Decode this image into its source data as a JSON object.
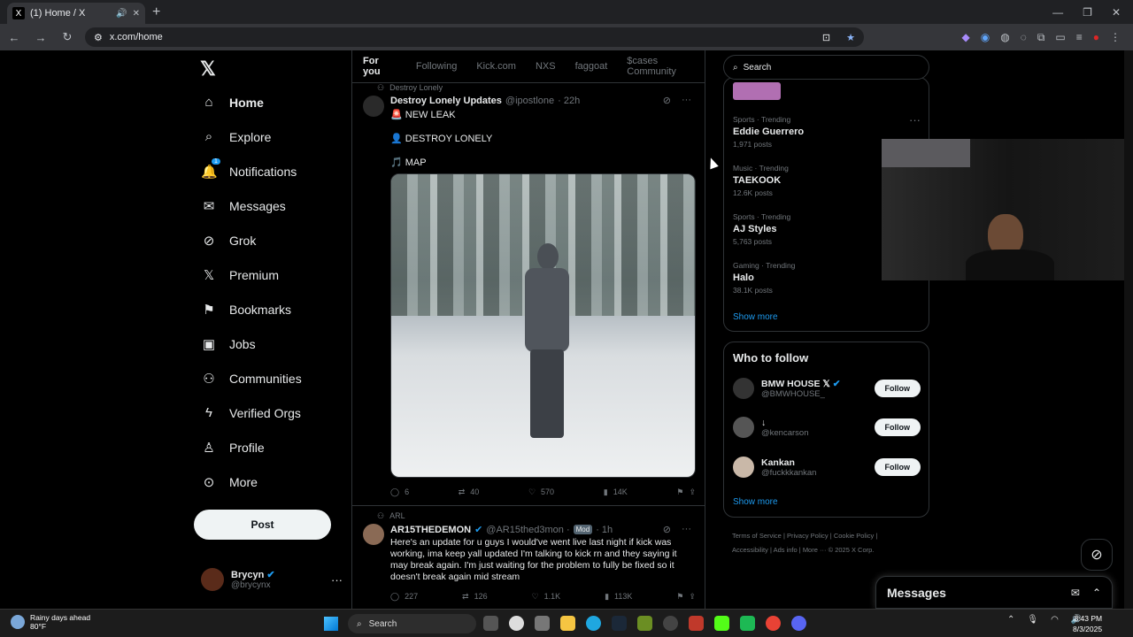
{
  "browser": {
    "tab_title": "(1) Home / X",
    "tab_favicon": "X",
    "new_tab": "+",
    "url": "x.com/home"
  },
  "nav": {
    "items": [
      {
        "label": "Home",
        "icon": "⌂",
        "active": true
      },
      {
        "label": "Explore",
        "icon": "⌕"
      },
      {
        "label": "Notifications",
        "icon": "🔔",
        "badge": "1"
      },
      {
        "label": "Messages",
        "icon": "✉"
      },
      {
        "label": "Grok",
        "icon": "⊘"
      },
      {
        "label": "Premium",
        "icon": "𝕏"
      },
      {
        "label": "Bookmarks",
        "icon": "⚑"
      },
      {
        "label": "Jobs",
        "icon": "▣"
      },
      {
        "label": "Communities",
        "icon": "⚇"
      },
      {
        "label": "Verified Orgs",
        "icon": "ϟ"
      },
      {
        "label": "Profile",
        "icon": "♙"
      },
      {
        "label": "More",
        "icon": "⊙"
      }
    ],
    "post_label": "Post",
    "account": {
      "name": "Brycyn",
      "handle": "@brycynx"
    }
  },
  "feed": {
    "tabs": [
      "For you",
      "Following",
      "Kick.com",
      "NXS",
      "faggoat",
      "$cases Community"
    ],
    "tweet1": {
      "context": "Destroy Lonely",
      "name": "Destroy Lonely Updates",
      "handle": "@ipostlone",
      "time": "· 22h",
      "lines": [
        "🚨 NEW LEAK",
        "👤 DESTROY LONELY",
        "🎵 MAP"
      ],
      "replies": "6",
      "reposts": "40",
      "likes": "570",
      "views": "14K"
    },
    "tweet2": {
      "context": "ARL",
      "name": "AR15THEDEMON",
      "handle": "@AR15thed3mon ·",
      "badge": "Mod",
      "time": "· 1h",
      "text": "Here's an update for u guys I would've went live last night if kick was working, ima keep yall updated I'm talking to kick rn and they saying it may break again. I'm just waiting for the problem to fully be fixed so it doesn't break again mid stream",
      "replies": "227",
      "reposts": "126",
      "likes": "1.1K",
      "views": "113K"
    }
  },
  "sidebar": {
    "search_placeholder": "Search",
    "trends": [
      {
        "category": "Sports · Trending",
        "title": "Eddie Guerrero",
        "posts": "1,971 posts"
      },
      {
        "category": "Music · Trending",
        "title": "TAEKOOK",
        "posts": "12.6K posts"
      },
      {
        "category": "Sports · Trending",
        "title": "AJ Styles",
        "posts": "5,763 posts"
      },
      {
        "category": "Gaming · Trending",
        "title": "Halo",
        "posts": "38.1K posts"
      }
    ],
    "show_more": "Show more",
    "who_to_follow_title": "Who to follow",
    "who_to_follow": [
      {
        "name": "BMW HOUSE 𝕏",
        "handle": "@BMWHOUSE_"
      },
      {
        "name": "↓",
        "handle": "@kencarson"
      },
      {
        "name": "Kankan",
        "handle": "@fuckkkankan"
      }
    ],
    "follow_label": "Follow",
    "footer": [
      "Terms of Service",
      "|",
      "Privacy Policy",
      "|",
      "Cookie Policy",
      "|",
      "Accessibility",
      "|",
      "Ads info",
      "|",
      "More ···",
      "© 2025 X Corp."
    ]
  },
  "messages_bar": {
    "title": "Messages"
  },
  "taskbar": {
    "weather_title": "Rainy days ahead",
    "weather_temp": "80°F",
    "search": "Search",
    "time": "8:43 PM",
    "date": "8/3/2025"
  },
  "colors": {
    "accent": "#1d9bf0",
    "background": "#000000",
    "border": "#2f3336"
  }
}
